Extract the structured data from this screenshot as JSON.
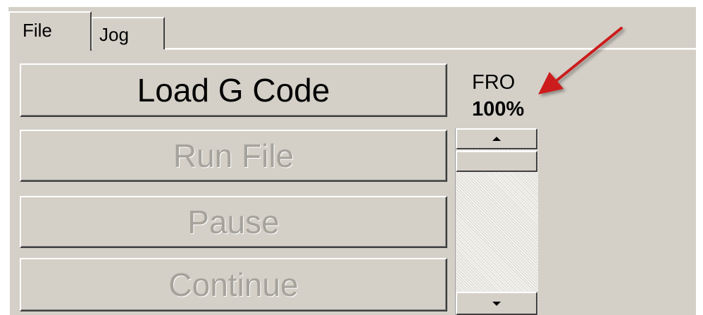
{
  "tabs": [
    {
      "label": "File",
      "active": true
    },
    {
      "label": "Jog",
      "active": false
    }
  ],
  "buttons": {
    "load": {
      "label": "Load G Code",
      "enabled": true
    },
    "run": {
      "label": "Run File",
      "enabled": false
    },
    "pause": {
      "label": "Pause",
      "enabled": false
    },
    "continue": {
      "label": "Continue",
      "enabled": false
    }
  },
  "fro": {
    "label": "FRO",
    "value": "100%"
  },
  "scrollbar": {
    "up_icon": "arrow-up-icon",
    "down_icon": "arrow-down-icon"
  },
  "colors": {
    "window_bg": "#d4d0c8",
    "disabled_text": "#a6a39c",
    "annotation_arrow": "#cc1f1f"
  }
}
